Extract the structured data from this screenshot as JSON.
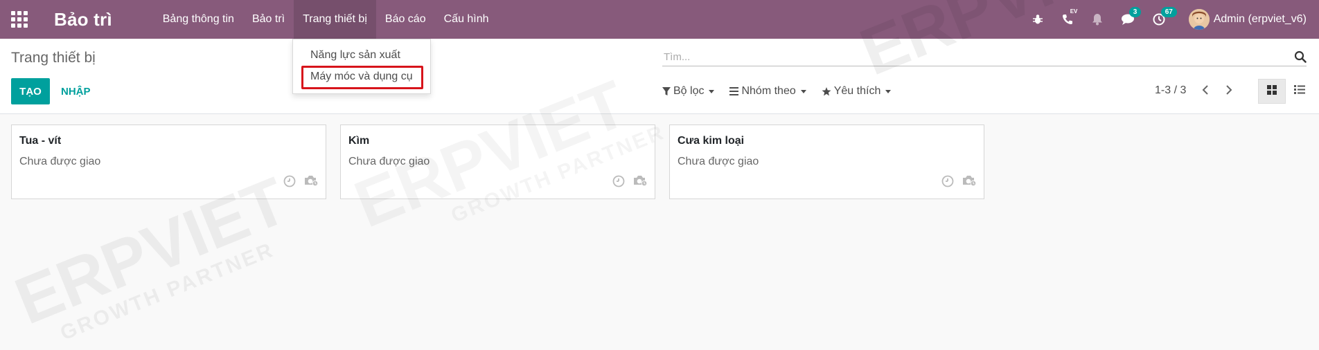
{
  "app": {
    "brand": "Bảo trì",
    "menu": [
      {
        "label": "Bảng thông tin"
      },
      {
        "label": "Bảo trì"
      },
      {
        "label": "Trang thiết bị"
      },
      {
        "label": "Báo cáo"
      },
      {
        "label": "Cấu hình"
      }
    ],
    "active_menu_index": 2
  },
  "systray": {
    "debug_icon": "bug-icon",
    "voip_icon": "phone-icon",
    "voip_label": "EV",
    "notification_icon": "bell-icon",
    "messages_icon": "chat-icon",
    "messages_count": "3",
    "activities_icon": "clock-icon",
    "activities_count": "67",
    "user_name": "Admin (erpviet_v6)"
  },
  "dropdown": {
    "items": [
      {
        "label": "Năng lực sản xuất"
      },
      {
        "label": "Máy móc và dụng cụ"
      }
    ],
    "highlighted_index": 1
  },
  "control_panel": {
    "title": "Trang thiết bị",
    "create_label": "TẠO",
    "import_label": "NHẬP",
    "search_placeholder": "Tìm...",
    "filters_label": "Bộ lọc",
    "group_by_label": "Nhóm theo",
    "favorites_label": "Yêu thích",
    "pager": "1-3 / 3",
    "active_view": "kanban"
  },
  "kanban": {
    "cards": [
      {
        "title": "Tua - vít",
        "status": "Chưa được giao"
      },
      {
        "title": "Kìm",
        "status": "Chưa được giao"
      },
      {
        "title": "Cưa kim loại",
        "status": "Chưa được giao"
      }
    ]
  },
  "watermark": {
    "text": "ERPVIET",
    "tagline": "GROWTH PARTNER"
  },
  "colors": {
    "navbar": "#875a7b",
    "primary": "#00a09d",
    "highlight_border": "#d7141b",
    "badge": "#00a09d"
  }
}
